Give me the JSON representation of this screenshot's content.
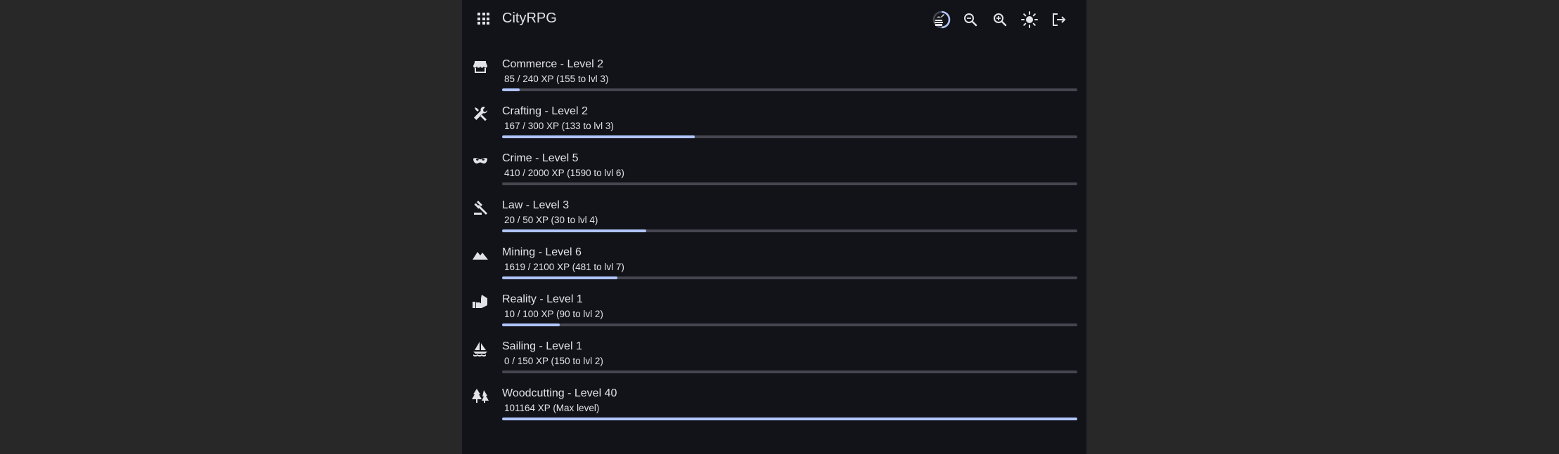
{
  "header": {
    "title": "CityRPG",
    "actions": [
      {
        "icon": "energy-gauge-icon"
      },
      {
        "icon": "zoom-out-icon"
      },
      {
        "icon": "zoom-in-icon"
      },
      {
        "icon": "brightness-icon"
      },
      {
        "icon": "logout-icon"
      }
    ]
  },
  "skills": [
    {
      "name": "Commerce - Level 2",
      "xp": "85 / 240 XP (155 to lvl 3)",
      "progress": 0.031,
      "icon": "storefront-icon"
    },
    {
      "name": "Crafting - Level 2",
      "xp": "167 / 300 XP (133 to lvl 3)",
      "progress": 0.335,
      "icon": "tools-icon"
    },
    {
      "name": "Crime - Level 5",
      "xp": "410 / 2000 XP (1590 to lvl 6)",
      "progress": 0.0,
      "icon": "mask-icon"
    },
    {
      "name": "Law - Level 3",
      "xp": "20 / 50 XP (30 to lvl 4)",
      "progress": 0.25,
      "icon": "gavel-icon"
    },
    {
      "name": "Mining - Level 6",
      "xp": "1619 / 2100 XP (481 to lvl 7)",
      "progress": 0.2,
      "icon": "mountain-icon"
    },
    {
      "name": "Reality - Level 1",
      "xp": "10 / 100 XP (90 to lvl 2)",
      "progress": 0.1,
      "icon": "house-hand-icon"
    },
    {
      "name": "Sailing - Level 1",
      "xp": "0 / 150 XP (150 to lvl 2)",
      "progress": 0.0,
      "icon": "sailboat-icon"
    },
    {
      "name": "Woodcutting - Level 40",
      "xp": "101164 XP (Max level)",
      "progress": 1.0,
      "icon": "trees-icon"
    }
  ],
  "colors": {
    "background": "#121318",
    "outer": "#282828",
    "text": "#e3e2e6",
    "track": "#45464f",
    "accent": "#b1c5ff"
  }
}
